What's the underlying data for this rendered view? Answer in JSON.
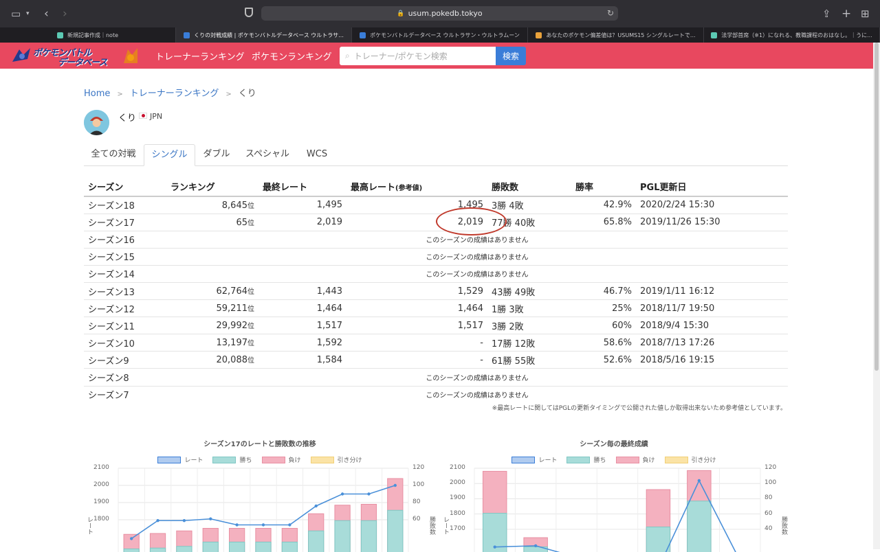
{
  "browser": {
    "url": "usum.pokedb.tokyo",
    "tabs": [
      {
        "title": "新規記事作成｜note",
        "fav_color": "#5cc9b3"
      },
      {
        "title": "くりの対戦成績 | ポケモンバトルデータベース ウルトラサ...",
        "fav_color": "#3a7dd8"
      },
      {
        "title": "ポケモンバトルデータベース ウルトラサン・ウルトラムーン",
        "fav_color": "#3a7dd8"
      },
      {
        "title": "あなたのポケモン偏差値は？USUMS15 シングルレートで...",
        "fav_color": "#e9a23b"
      },
      {
        "title": "法学部首席（※1）になれる、教職課程のおはなし。｜うに...",
        "fav_color": "#5cc9b3"
      }
    ]
  },
  "site": {
    "logo_line1": "ポケモンバトル",
    "logo_line2": "データベース",
    "nav": [
      "トレーナーランキング",
      "ポケモンランキング"
    ],
    "search_placeholder": "トレーナー/ポケモン検索",
    "search_button": "検索"
  },
  "breadcrumb": [
    "Home",
    "トレーナーランキング",
    "くり"
  ],
  "user": {
    "name": "くり",
    "country": "JPN"
  },
  "tabs": [
    "全ての対戦",
    "シングル",
    "ダブル",
    "スペシャル",
    "WCS"
  ],
  "active_tab": 1,
  "table": {
    "headers": [
      "シーズン",
      "ランキング",
      "最終レート",
      "最高レート",
      "(参考値)",
      "勝敗数",
      "勝率",
      "PGL更新日"
    ],
    "rank_suffix": "位",
    "no_record": "このシーズンの成績はありません",
    "rows": [
      {
        "season": "シーズン18",
        "rank": "8,645",
        "final": "1,495",
        "max": "1,495",
        "wl": "3勝 4敗",
        "rate": "42.9%",
        "date": "2020/2/24 15:30"
      },
      {
        "season": "シーズン17",
        "rank": "65",
        "final": "2,019",
        "max": "2,019",
        "wl": "77勝 40敗",
        "rate": "65.8%",
        "date": "2019/11/26 15:30"
      },
      {
        "season": "シーズン16"
      },
      {
        "season": "シーズン15"
      },
      {
        "season": "シーズン14"
      },
      {
        "season": "シーズン13",
        "rank": "62,764",
        "final": "1,443",
        "max": "1,529",
        "wl": "43勝 49敗",
        "rate": "46.7%",
        "date": "2019/1/11 16:12"
      },
      {
        "season": "シーズン12",
        "rank": "59,211",
        "final": "1,464",
        "max": "1,464",
        "wl": "1勝 3敗",
        "rate": "25%",
        "date": "2018/11/7 19:50"
      },
      {
        "season": "シーズン11",
        "rank": "29,992",
        "final": "1,517",
        "max": "1,517",
        "wl": "3勝 2敗",
        "rate": "60%",
        "date": "2018/9/4 15:30"
      },
      {
        "season": "シーズン10",
        "rank": "13,197",
        "final": "1,592",
        "max": "-",
        "wl": "17勝 12敗",
        "rate": "58.6%",
        "date": "2018/7/13 17:26"
      },
      {
        "season": "シーズン9",
        "rank": "20,088",
        "final": "1,584",
        "max": "-",
        "wl": "61勝 55敗",
        "rate": "52.6%",
        "date": "2018/5/16 19:15"
      },
      {
        "season": "シーズン8"
      },
      {
        "season": "シーズン7"
      }
    ],
    "note": "※最高レートに関してはPGLの更新タイミングで公開された値しか取得出来ないため参考値としています。"
  },
  "colors": {
    "header": "#e8485f",
    "rate": "#3a7dd8",
    "win": "#a8dcd9",
    "lose": "#f4b1bf",
    "draw": "#fbe3a6"
  },
  "chart_data": [
    {
      "type": "bar",
      "title": "シーズン17のレートと勝敗数の推移",
      "legend": [
        "レート",
        "勝ち",
        "負け",
        "引き分け"
      ],
      "ylabel": "レート",
      "y2label": "勝敗数",
      "y_ticks": [
        "2100",
        "2000",
        "1900",
        "1800"
      ],
      "y2_ticks": [
        "120",
        "100",
        "80",
        "60"
      ],
      "ylim": [
        1700,
        2100
      ],
      "y2lim": [
        40,
        120
      ],
      "rate": [
        1690,
        1795,
        1795,
        1805,
        1770,
        1770,
        1770,
        1880,
        1950,
        1950,
        2000
      ],
      "win": [
        26,
        27,
        29,
        34,
        34,
        34,
        34,
        47,
        59,
        59,
        71
      ],
      "lose": [
        43,
        44,
        47,
        50,
        50,
        50,
        50,
        67,
        77,
        78,
        108
      ]
    },
    {
      "type": "bar",
      "title": "シーズン毎の最終成績",
      "legend": [
        "レート",
        "勝ち",
        "負け",
        "引き分け"
      ],
      "ylabel": "レート",
      "y2label": "勝敗数",
      "y_ticks": [
        "2100",
        "2000",
        "1900",
        "1800",
        "1700"
      ],
      "y2_ticks": [
        "120",
        "100",
        "80",
        "60",
        "40"
      ],
      "ylim": [
        1650,
        2100
      ],
      "y2lim": [
        30,
        120
      ],
      "rate": [
        1584,
        1592,
        1517,
        1464,
        1443,
        2019,
        1495
      ],
      "win": [
        61,
        17,
        3,
        1,
        43,
        77,
        3
      ],
      "lose": [
        116,
        29,
        5,
        4,
        92,
        117,
        7
      ]
    }
  ]
}
